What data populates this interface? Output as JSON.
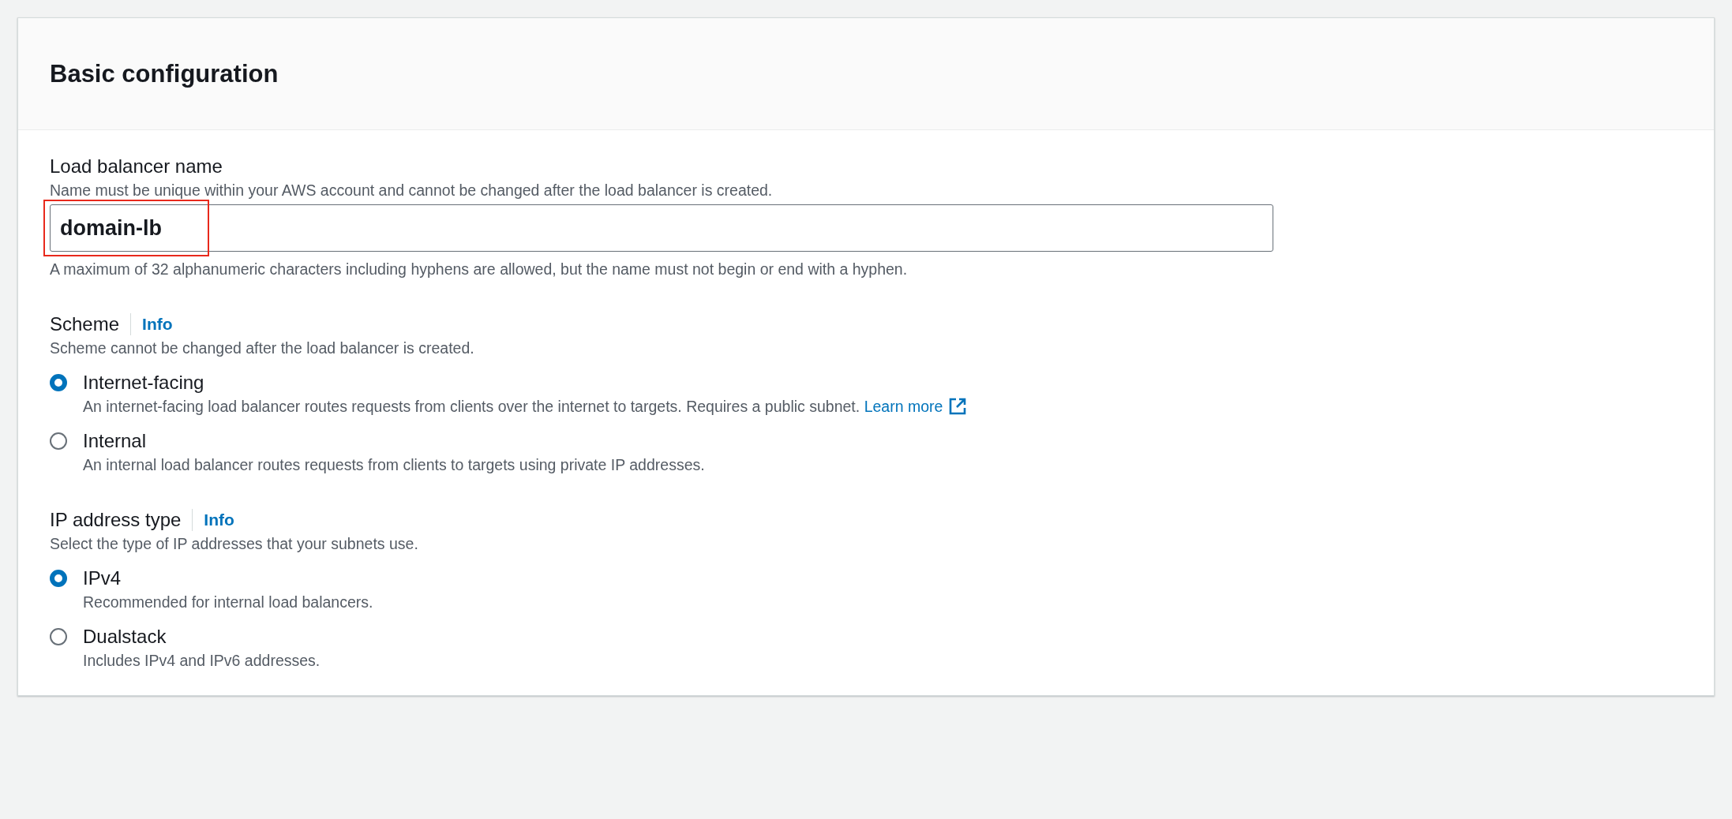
{
  "panel": {
    "title": "Basic configuration"
  },
  "name_field": {
    "label": "Load balancer name",
    "description": "Name must be unique within your AWS account and cannot be changed after the load balancer is created.",
    "value": "domain-lb",
    "highlighted": true,
    "constraint": "A maximum of 32 alphanumeric characters including hyphens are allowed, but the name must not begin or end with a hyphen."
  },
  "radio_groups": [
    {
      "label": "Scheme",
      "info": "Info",
      "description": "Scheme cannot be changed after the load balancer is created.",
      "options": [
        {
          "label": "Internet-facing",
          "description": "An internet-facing load balancer routes requests from clients over the internet to targets. Requires a public subnet.",
          "link": "Learn more",
          "selected": true
        },
        {
          "label": "Internal",
          "description": "An internal load balancer routes requests from clients to targets using private IP addresses.",
          "selected": false
        }
      ]
    },
    {
      "label": "IP address type",
      "info": "Info",
      "description": "Select the type of IP addresses that your subnets use.",
      "options": [
        {
          "label": "IPv4",
          "description": "Recommended for internal load balancers.",
          "selected": true
        },
        {
          "label": "Dualstack",
          "description": "Includes IPv4 and IPv6 addresses.",
          "selected": false
        }
      ]
    }
  ]
}
